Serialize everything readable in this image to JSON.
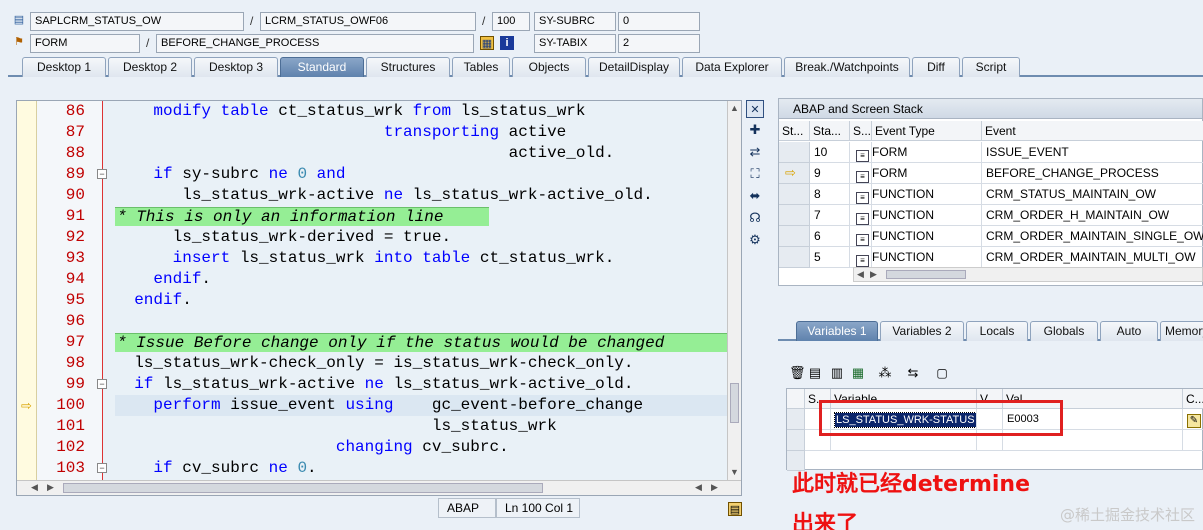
{
  "header": {
    "program": "SAPLCRM_STATUS_OW",
    "include": "LCRM_STATUS_OWF06",
    "line": "100",
    "var1_name": "SY-SUBRC",
    "var1_value": "0",
    "event_type": "FORM",
    "event_name": "BEFORE_CHANGE_PROCESS",
    "var2_name": "SY-TABIX",
    "var2_value": "2",
    "slash": "/"
  },
  "tabs": [
    "Desktop 1",
    "Desktop 2",
    "Desktop 3",
    "Standard",
    "Structures",
    "Tables",
    "Objects",
    "DetailDisplay",
    "Data Explorer",
    "Break./Watchpoints",
    "Diff",
    "Script"
  ],
  "active_tab": "Standard",
  "code": {
    "lines": [
      {
        "n": "86",
        "text": "    modify table ct_status_wrk from ls_status_wrk"
      },
      {
        "n": "87",
        "text": "                            transporting active"
      },
      {
        "n": "88",
        "text": "                                         active_old."
      },
      {
        "n": "89",
        "text": "    if sy-subrc ne 0 and"
      },
      {
        "n": "90",
        "text": "       ls_status_wrk-active ne ls_status_wrk-active_old."
      },
      {
        "n": "91",
        "text": "* This is only an information line"
      },
      {
        "n": "92",
        "text": "      ls_status_wrk-derived = true."
      },
      {
        "n": "93",
        "text": "      insert ls_status_wrk into table ct_status_wrk."
      },
      {
        "n": "94",
        "text": "    endif."
      },
      {
        "n": "95",
        "text": "  endif."
      },
      {
        "n": "96",
        "text": ""
      },
      {
        "n": "97",
        "text": "* Issue Before change only if the status would be changed"
      },
      {
        "n": "98",
        "text": "  ls_status_wrk-check_only = is_status_wrk-check_only."
      },
      {
        "n": "99",
        "text": "  if ls_status_wrk-active ne ls_status_wrk-active_old."
      },
      {
        "n": "100",
        "text": "    perform issue_event using    gc_event-before_change"
      },
      {
        "n": "101",
        "text": "                                 ls_status_wrk"
      },
      {
        "n": "102",
        "text": "                       changing cv_subrc."
      },
      {
        "n": "103",
        "text": "    if cv_subrc ne 0."
      }
    ]
  },
  "statusbar": {
    "lang": "ABAP",
    "pos": "Ln 100 Col 1"
  },
  "stack": {
    "title": "ABAP and Screen Stack",
    "columns": [
      "St...",
      "Sta...",
      "S...",
      "Event Type",
      "Event"
    ],
    "rows": [
      {
        "status": "10",
        "type": "FORM",
        "event": "ISSUE_EVENT",
        "current": false
      },
      {
        "status": "9",
        "type": "FORM",
        "event": "BEFORE_CHANGE_PROCESS",
        "current": true
      },
      {
        "status": "8",
        "type": "FUNCTION",
        "event": "CRM_STATUS_MAINTAIN_OW",
        "current": false
      },
      {
        "status": "7",
        "type": "FUNCTION",
        "event": "CRM_ORDER_H_MAINTAIN_OW",
        "current": false
      },
      {
        "status": "6",
        "type": "FUNCTION",
        "event": "CRM_ORDER_MAINTAIN_SINGLE_OW",
        "current": false
      },
      {
        "status": "5",
        "type": "FUNCTION",
        "event": "CRM_ORDER_MAINTAIN_MULTI_OW",
        "current": false
      }
    ]
  },
  "var_tabs": [
    "Variables 1",
    "Variables 2",
    "Locals",
    "Globals",
    "Auto",
    "Memory"
  ],
  "active_var_tab": "Variables 1",
  "vars": {
    "columns": [
      "S...",
      "Variable",
      "V...",
      "Val...",
      "C..."
    ],
    "rows": [
      {
        "name": "LS_STATUS_WRK-STATUS",
        "value": "E0003"
      }
    ]
  },
  "annotation": {
    "line1": "此时就已经determine",
    "line2": "出来了",
    "color": "#ee1111"
  },
  "watermark": "@稀土掘金技术社区",
  "colors": {
    "active_tab": "#5f82ad",
    "comment_bg": "#95ee95",
    "keyword": "#0000ff",
    "line_number": "#c00000"
  }
}
